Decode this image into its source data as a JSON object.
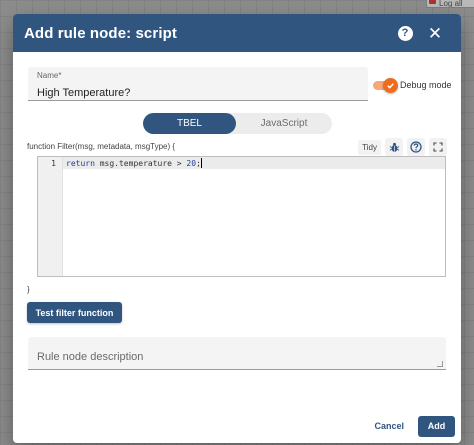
{
  "background": {
    "node_label": "Log all"
  },
  "dialog": {
    "title": "Add rule node: script",
    "help_icon": "help-icon",
    "close_icon": "close-icon"
  },
  "name": {
    "label": "Name*",
    "value": "High Temperature?"
  },
  "debug": {
    "label": "Debug mode",
    "enabled": true
  },
  "language": {
    "options": [
      "TBEL",
      "JavaScript"
    ],
    "selected": "TBEL"
  },
  "editor": {
    "signature": "function Filter(msg, metadata, msgType) {",
    "closing": "}",
    "tidy_label": "Tidy",
    "line_number": "1",
    "code_keyword": "return",
    "code_body": " msg.temperature > ",
    "code_number": "20",
    "code_end": ";",
    "tools": [
      "bug-icon",
      "help-icon",
      "fullscreen-icon"
    ]
  },
  "test_button": "Test filter function",
  "description": {
    "placeholder": "Rule node description"
  },
  "footer": {
    "cancel": "Cancel",
    "add": "Add"
  },
  "colors": {
    "primary": "#305680",
    "accent_toggle": "#ef6c1e"
  }
}
